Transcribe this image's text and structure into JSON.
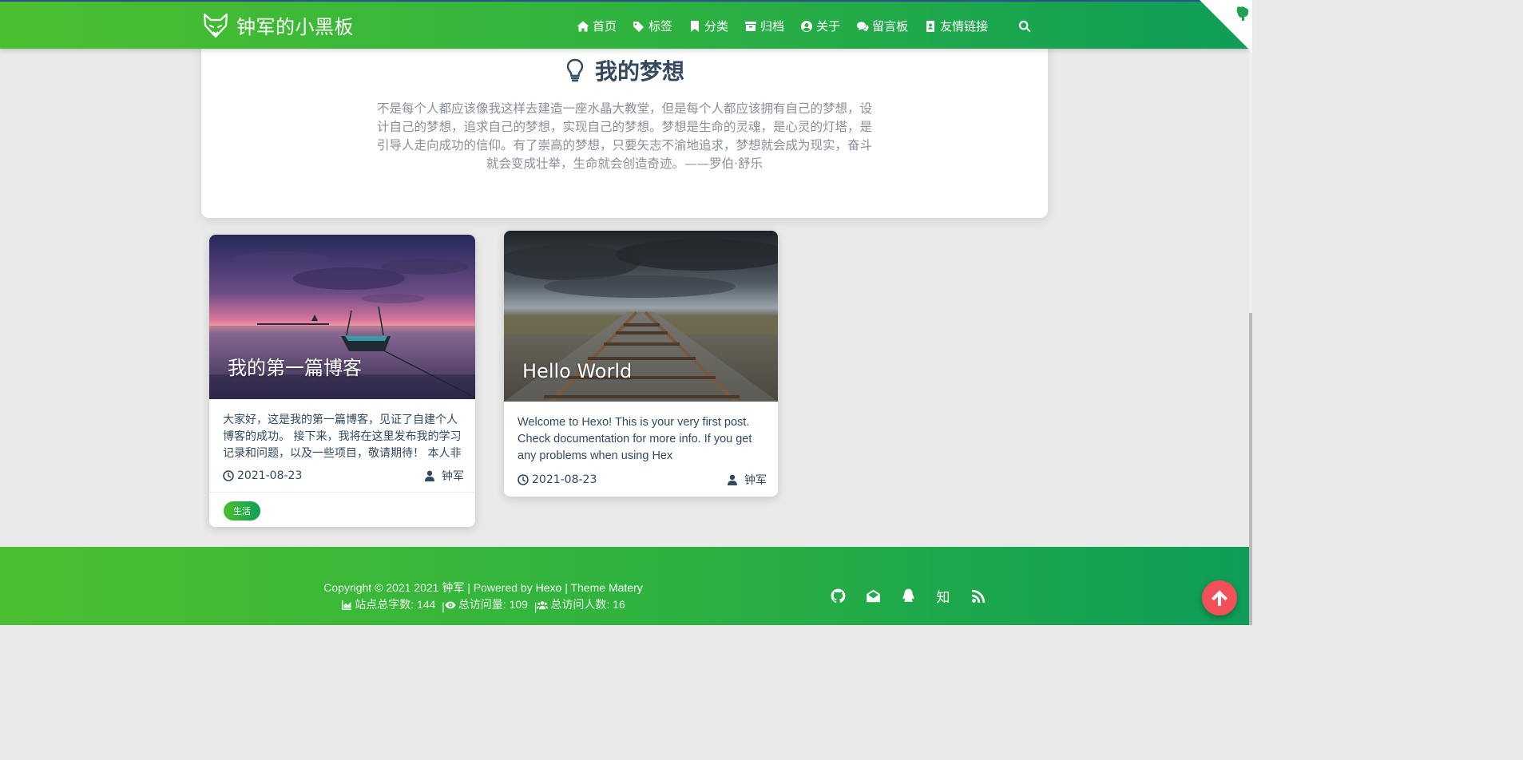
{
  "header": {
    "brand": "钟军的小黑板",
    "nav": [
      {
        "label": "首页",
        "icon": "home-icon"
      },
      {
        "label": "标签",
        "icon": "tags-icon"
      },
      {
        "label": "分类",
        "icon": "bookmark-icon"
      },
      {
        "label": "归档",
        "icon": "archive-icon"
      },
      {
        "label": "关于",
        "icon": "user-circle-icon"
      },
      {
        "label": "留言板",
        "icon": "comments-icon"
      },
      {
        "label": "友情链接",
        "icon": "address-book-icon"
      }
    ]
  },
  "dream": {
    "title": "我的梦想",
    "text": "不是每个人都应该像我这样去建造一座水晶大教堂，但是每个人都应该拥有自己的梦想，设计自己的梦想，追求自己的梦想，实现自己的梦想。梦想是生命的灵魂，是心灵的灯塔，是引导人走向成功的信仰。有了崇高的梦想，只要矢志不渝地追求，梦想就会成为现实，奋斗就会变成壮举，生命就会创造奇迹。——罗伯·舒乐"
  },
  "posts": [
    {
      "title": "我的第一篇博客",
      "excerpt": "大家好，这是我的第一篇博客，见证了自建个人博客的成功。 接下来，我将在这里发布我的学习记录和问题，以及一些项目，敬请期待！ 本人非常...",
      "date": "2021-08-23",
      "author": "钟军",
      "tag": "生活"
    },
    {
      "title": "Hello World",
      "excerpt": "Welcome to Hexo! This is your very first post. Check documentation for more info. If you get any problems when using Hex",
      "date": "2021-08-23",
      "author": "钟军"
    }
  ],
  "footer": {
    "copyright_prefix": "Copyright © 2021 2021",
    "owner": "钟军",
    "powered_by": "| Powered by",
    "engine": "Hexo",
    "theme_label": "| Theme",
    "theme": "Matery",
    "word_count_label": "站点总字数:",
    "word_count": "144",
    "pv_label": "总访问量:",
    "pv": "109",
    "uv_label": "总访问人数:",
    "uv": "16",
    "zhihu_glyph": "知"
  },
  "colors": {
    "brand_green_start": "#4cbf30",
    "brand_green_end": "#0f9d58",
    "back_to_top": "#f25059"
  }
}
